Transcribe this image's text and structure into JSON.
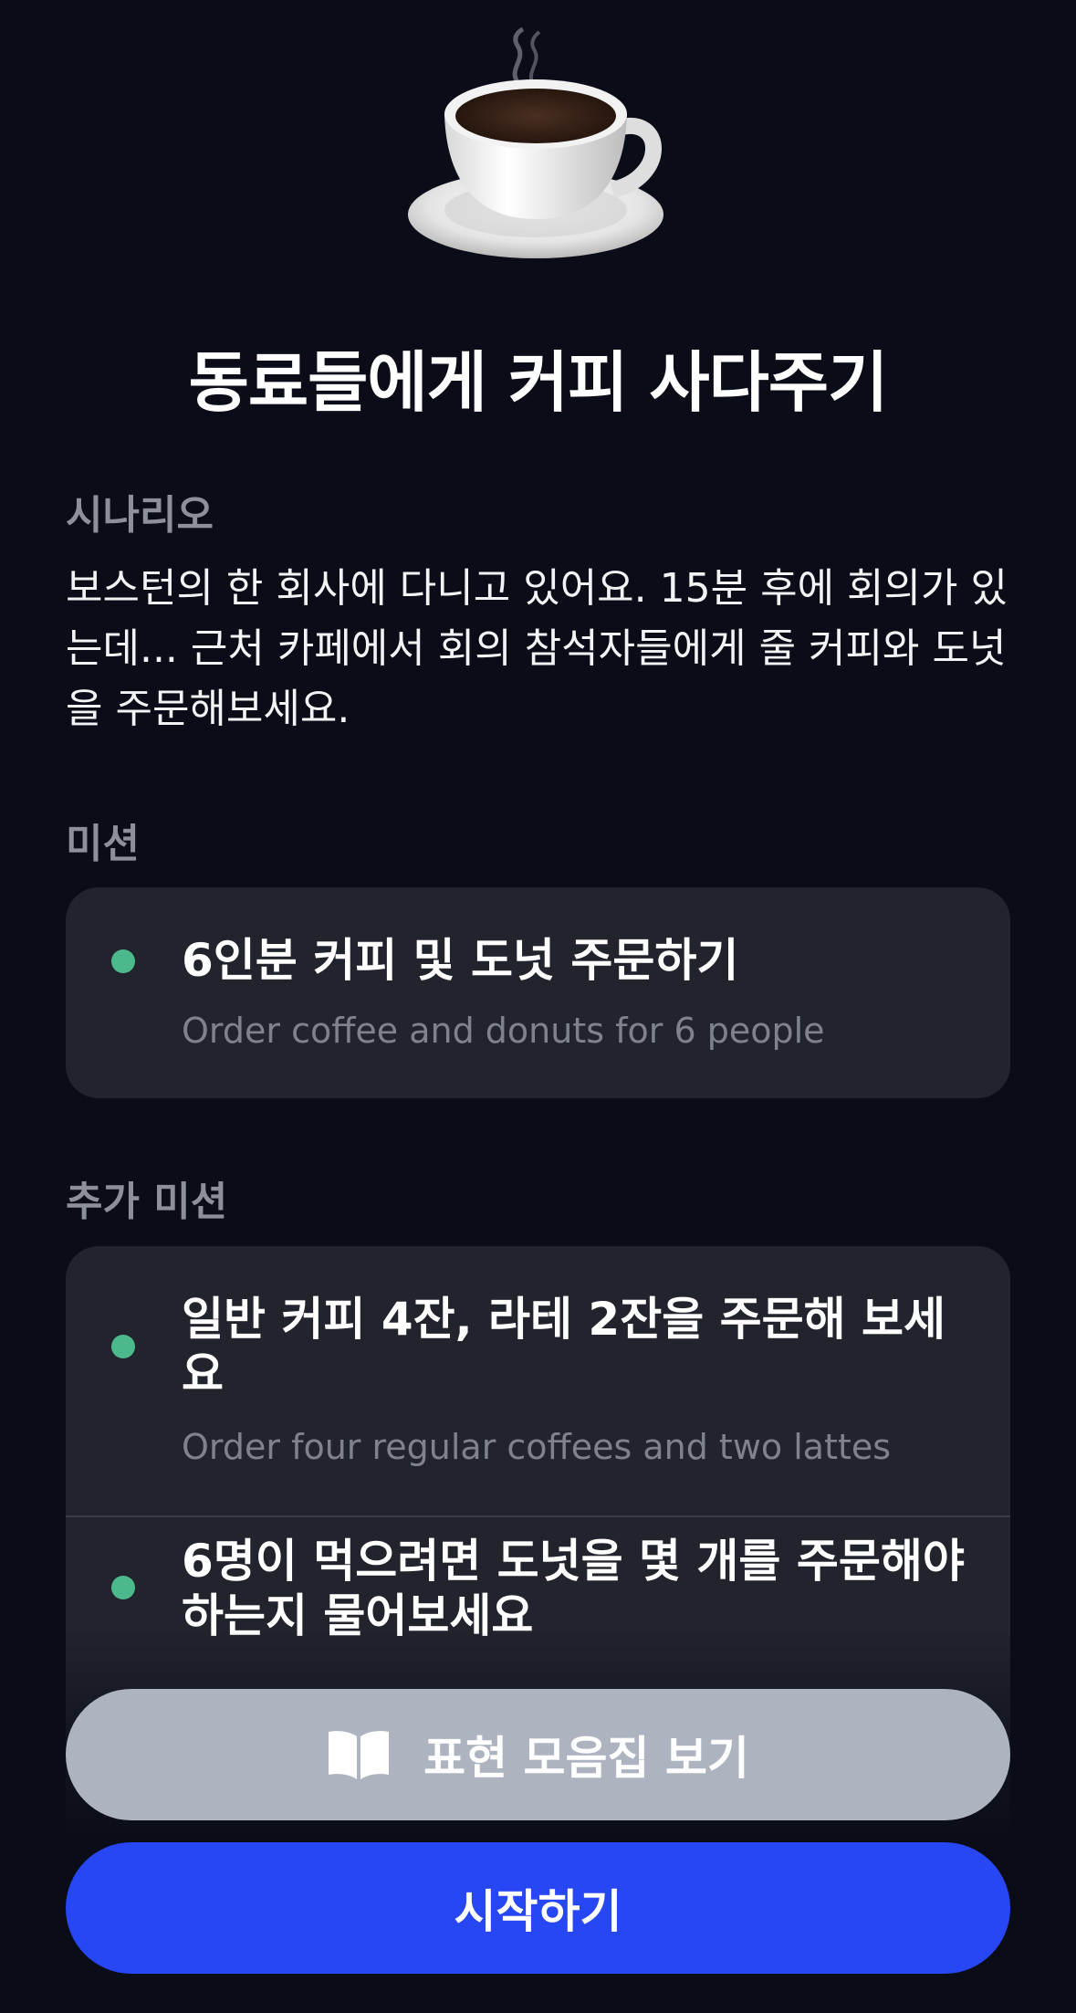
{
  "header": {
    "icon": "coffee-cup-icon",
    "title": "동료들에게 커피 사다주기"
  },
  "scenario": {
    "label": "시나리오",
    "text": "보스턴의 한 회사에 다니고 있어요. 15분 후에 회의가 있는데... 근처 카페에서 회의 참석자들에게 줄 커피와 도넛을 주문해보세요."
  },
  "mission": {
    "label": "미션",
    "items": [
      {
        "title": "6인분 커피 및 도넛 주문하기",
        "subtitle": "Order coffee and donuts for 6 people"
      }
    ]
  },
  "extra_mission": {
    "label": "추가 미션",
    "items": [
      {
        "title": "일반 커피 4잔, 라테 2잔을 주문해 보세요",
        "subtitle": "Order four regular coffees and two lattes"
      },
      {
        "title": "6명이 먹으려면 도넛을 몇 개를 주문해야 하는지 물어보세요",
        "subtitle": ""
      }
    ]
  },
  "buttons": {
    "phrase_book": {
      "label": "표현 모음집 보기",
      "icon": "open-book-icon",
      "color": "#adb4c0"
    },
    "start": {
      "label": "시작하기",
      "color": "#2747f5"
    }
  },
  "colors": {
    "background": "#0a0c17",
    "card": "#21232d",
    "bullet": "#4cb98c"
  }
}
